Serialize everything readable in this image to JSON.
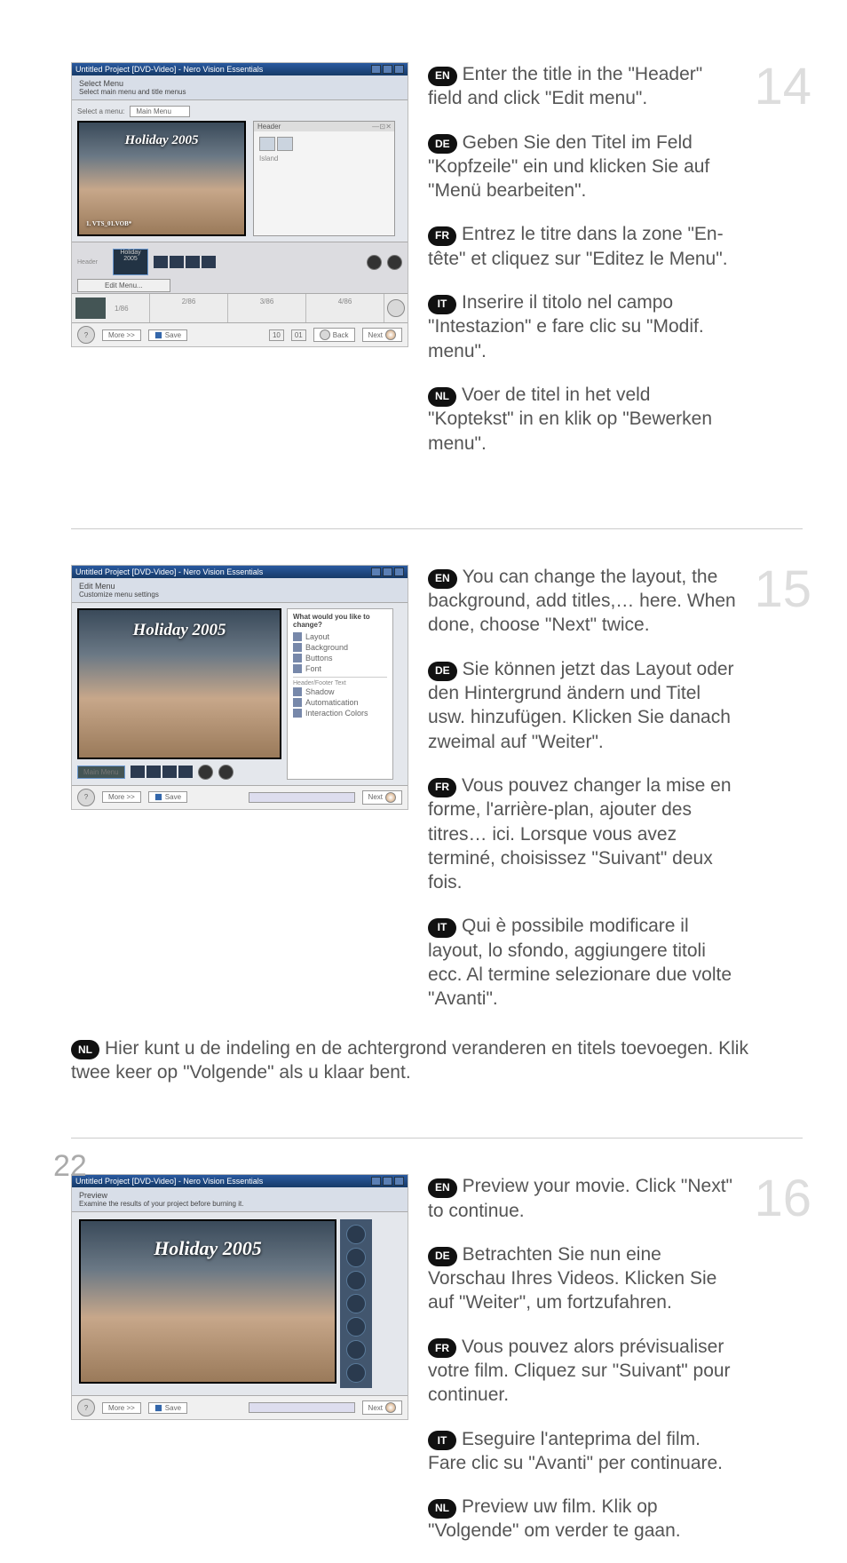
{
  "page_number": "22",
  "steps": [
    {
      "num": "14",
      "shot": {
        "window_title": "Untitled Project [DVD-Video] - Nero Vision Essentials",
        "heading": "Select Menu",
        "subheading": "Select main menu and title menus",
        "dropdown_label": "Select a menu:",
        "dropdown_value": "Main Menu",
        "header_panel_label": "Header",
        "video_label": "Holiday 2005",
        "clip1": "Header",
        "clip2": "Holiday 2005",
        "edit_btn": "Edit Menu...",
        "t_left": "1/86",
        "t1": "2/86",
        "t2": "3/86",
        "t3": "4/86",
        "more_btn": "More >>",
        "save_btn": "Save",
        "back_btn": "Back",
        "next_btn": "Next"
      },
      "en": "Enter the title in the \"Header\" field and click \"Edit menu\".",
      "de": "Geben Sie den Titel im Feld \"Kopfzeile\" ein und klicken Sie auf \"Menü bearbeiten\".",
      "fr": "Entrez le titre dans la zone \"En-tête\" et cliquez sur \"Editez le Menu\".",
      "it": "Inserire il titolo nel campo \"Intestazion\" e fare clic su \"Modif. menu\".",
      "nl": "Voer de titel in het veld \"Koptekst\" in en klik op \"Bewerken menu\"."
    },
    {
      "num": "15",
      "shot": {
        "window_title": "Untitled Project [DVD-Video] - Nero Vision Essentials",
        "heading": "Edit Menu",
        "subheading": "Customize menu settings",
        "panel_hdr": "What would you like to change?",
        "items1": [
          "Layout",
          "Background",
          "Buttons",
          "Font"
        ],
        "sec2_hdr": "Header/Footer Text",
        "items2": [
          "Shadow",
          "Automatication",
          "Interaction Colors"
        ],
        "video_label": "Holiday 2005",
        "main_menu": "Main Menu",
        "more_btn": "More >>",
        "save_btn": "Save",
        "next_btn": "Next"
      },
      "en": "You can change the layout, the background, add titles,… here. When done, choose \"Next\" twice.",
      "de": "Sie können jetzt das Layout oder den Hintergrund ändern und Titel usw. hinzufügen. Klicken Sie danach zweimal auf \"Weiter\".",
      "fr": "Vous pouvez changer la mise en forme, l'arrière-plan, ajouter des titres… ici. Lorsque vous avez terminé, choisissez \"Suivant\" deux fois.",
      "it": "Qui è possibile modificare il layout, lo sfondo, aggiungere titoli ecc. Al termine selezionare due volte \"Avanti\".",
      "nl": "Hier kunt u de indeling en de achtergrond veranderen en titels toevoegen. Klik twee keer op \"Volgende\" als u klaar bent."
    },
    {
      "num": "16",
      "shot": {
        "window_title": "Untitled Project [DVD-Video] - Nero Vision Essentials",
        "heading": "Preview",
        "subheading": "Examine the results of your project before burning it.",
        "video_label": "Holiday 2005",
        "more_btn": "More >>",
        "save_btn": "Save",
        "next_btn": "Next"
      },
      "en": "Preview your movie. Click \"Next\" to continue.",
      "de": "Betrachten Sie nun eine Vorschau Ihres Videos. Klicken Sie auf \"Weiter\", um fortzufahren.",
      "fr": "Vous pouvez alors prévisualiser votre film. Cliquez sur \"Suivant\" pour continuer.",
      "it": "Eseguire l'anteprima del film. Fare clic su \"Avanti\" per continuare.",
      "nl": "Preview uw film. Klik op \"Volgende\" om verder te gaan."
    }
  ],
  "lang": {
    "en": "EN",
    "de": "DE",
    "fr": "FR",
    "it": "IT",
    "nl": "NL"
  }
}
